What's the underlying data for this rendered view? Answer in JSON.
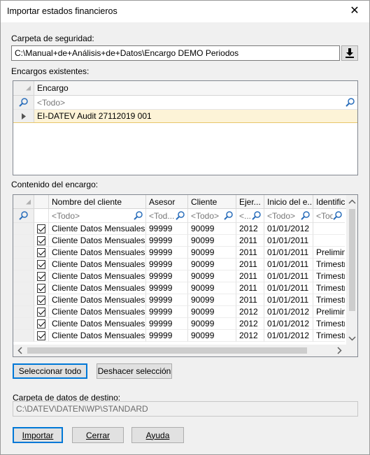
{
  "window": {
    "title": "Importar estados financieros"
  },
  "backup": {
    "label": "Carpeta de seguridad:",
    "path": "C:\\Manual+de+Análisis+de+Datos\\Encargo DEMO Periodos"
  },
  "engagements": {
    "label": "Encargos existentes:",
    "header": "Encargo",
    "filter_placeholder": "<Todo>",
    "rows": [
      "EI-DATEV Audit 27112019 001"
    ]
  },
  "contents": {
    "label": "Contenido del encargo:",
    "columns": [
      "Nombre del cliente",
      "Asesor",
      "Cliente",
      "Ejer...",
      "Inicio del e...",
      "Identifica"
    ],
    "filters": [
      "<Todo>",
      "<Tod...",
      "<Todo>",
      "<...",
      "<Todo>",
      "<Todo>"
    ],
    "rows": [
      [
        "Cliente Datos Mensuales ...",
        "99999",
        "90099",
        "2012",
        "01/01/2012",
        ""
      ],
      [
        "Cliente Datos Mensuales ...",
        "99999",
        "90099",
        "2011",
        "01/01/2011",
        ""
      ],
      [
        "Cliente Datos Mensuales ...",
        "99999",
        "90099",
        "2011",
        "01/01/2011",
        "Prelimina"
      ],
      [
        "Cliente Datos Mensuales ...",
        "99999",
        "90099",
        "2011",
        "01/01/2011",
        "Trimestre"
      ],
      [
        "Cliente Datos Mensuales ...",
        "99999",
        "90099",
        "2011",
        "01/01/2011",
        "Trimestre"
      ],
      [
        "Cliente Datos Mensuales ...",
        "99999",
        "90099",
        "2011",
        "01/01/2011",
        "Trimestre"
      ],
      [
        "Cliente Datos Mensuales ...",
        "99999",
        "90099",
        "2011",
        "01/01/2011",
        "Trimestre"
      ],
      [
        "Cliente Datos Mensuales ...",
        "99999",
        "90099",
        "2012",
        "01/01/2012",
        "Prelimina"
      ],
      [
        "Cliente Datos Mensuales ...",
        "99999",
        "90099",
        "2012",
        "01/01/2012",
        "Trimestre"
      ],
      [
        "Cliente Datos Mensuales ...",
        "99999",
        "90099",
        "2012",
        "01/01/2012",
        "Trimestre"
      ]
    ]
  },
  "buttons": {
    "select_all": "Seleccionar todo",
    "undo_selection": "Deshacer selección",
    "import": "Importar",
    "close": "Cerrar",
    "help": "Ayuda"
  },
  "destination": {
    "label": "Carpeta de datos de destino:",
    "path": "C:\\DATEV\\DATEN\\WP\\STANDARD"
  },
  "icons": [
    "close-icon",
    "download-icon",
    "search-icon",
    "row-arrow-icon",
    "scroll-up-icon",
    "scroll-down-icon",
    "scroll-left-icon",
    "scroll-right-icon"
  ]
}
